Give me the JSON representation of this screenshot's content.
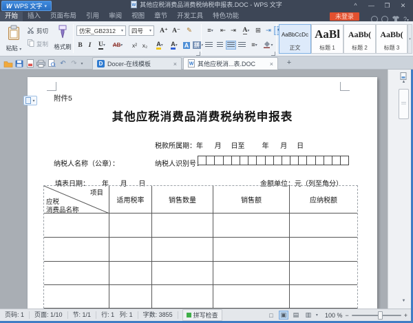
{
  "icons": {
    "app_logo": "W",
    "doc_w": "W",
    "docer_d": "D",
    "dropdown": "▾",
    "collapse": "^",
    "minimize": "—",
    "maximize": "❐",
    "close": "✕",
    "tab_close": "×",
    "new_tab": "+",
    "undo": "↶",
    "redo": "↷",
    "help": "?",
    "bold": "B",
    "italic": "I",
    "underline": "U",
    "strikethrough": "AB",
    "superscript": "x²",
    "subscript": "x₂",
    "highlight": "A",
    "font_color": "A",
    "char_shading": "A",
    "phonetic": "拼",
    "grow_font": "A⁺",
    "shrink_font": "A⁻",
    "text_effect": "✎",
    "bullets": "≡",
    "indent_decrease": "⇤",
    "indent_increase": "⇥",
    "char_scale": "A",
    "borders_small": "⊞",
    "tab_plus": "⇥",
    "show_marks": "¶",
    "line_spacing": "≡",
    "border_grid": "⊞",
    "spell_ok": "■",
    "scroll_up": "▲",
    "scroll_down": "▼",
    "view_fullscreen": "□",
    "view_page": "▣",
    "view_outline": "▤",
    "view_read": "▥",
    "zoom_out": "−",
    "zoom_in": "+"
  },
  "titlebar": {
    "app_button": "WPS 文字",
    "doc_title": "其他应税消费品消费税纳税申报表.DOC - WPS 文字"
  },
  "menubar": {
    "tabs": [
      "开始",
      "插入",
      "页面布局",
      "引用",
      "审阅",
      "视图",
      "章节",
      "开发工具",
      "特色功能"
    ],
    "login": "未登录"
  },
  "ribbon": {
    "paste": "粘贴",
    "cut": "剪切",
    "copy": "复制",
    "format_painter": "格式刷",
    "font_name": "仿宋_GB2312",
    "font_size": "四号",
    "styles": [
      {
        "preview": "AaBbCcDc",
        "label": "正文"
      },
      {
        "preview": "AaBl",
        "label": "标题 1"
      },
      {
        "preview": "AaBb(",
        "label": "标题 2"
      },
      {
        "preview": "AaBb(",
        "label": "标题 3"
      }
    ]
  },
  "tabbar": {
    "tabs": [
      "Docer-在线模板",
      "其他应税消...表.DOC"
    ]
  },
  "document": {
    "attachment": "附件5",
    "title": "其他应税消费品消费税纳税申报表",
    "tax_period_label": "税款所属期：",
    "tax_period_fields": "年      月     日至         年      月     日",
    "taxpayer_name_label": "纳税人名称（公章）：",
    "taxpayer_id_label": "纳税人识别号：",
    "fill_date_label": "填表日期：",
    "fill_date_fields": "年      月      日",
    "amount_unit": "金额单位：元（列至角分）",
    "table": {
      "corner_top": "项目",
      "corner_line1": "应税",
      "corner_line2": "消费品名称",
      "headers": [
        "适用税率",
        "销售数量",
        "销售额",
        "应纳税额"
      ]
    }
  },
  "statusbar": {
    "page": "页码: 1",
    "pages": "页面: 1/10",
    "section": "节: 1/1",
    "line_col": "行: 1   列: 1",
    "words": "字数: 3855",
    "spellcheck": "拼写检查",
    "zoom_value": "100 %"
  }
}
